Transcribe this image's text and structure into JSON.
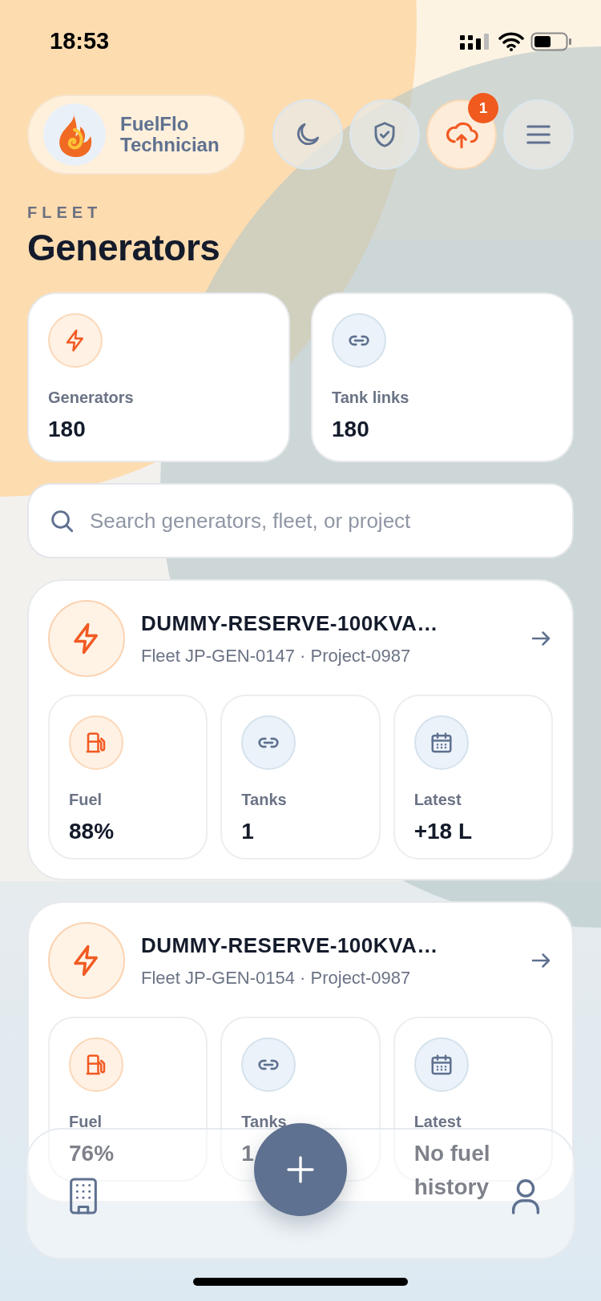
{
  "status_bar": {
    "time": "18:53"
  },
  "header": {
    "app_name": "FuelFlo",
    "role": "Technician",
    "sync_badge": "1"
  },
  "section_label": "FLEET",
  "title": "Generators",
  "summary": [
    {
      "kind": "power",
      "label": "Generators",
      "value": "180"
    },
    {
      "kind": "link",
      "label": "Tank links",
      "value": "180"
    }
  ],
  "search": {
    "placeholder": "Search generators, fleet, or project"
  },
  "generators": [
    {
      "name": "DUMMY-RESERVE-100KVA…",
      "subtitle": "Fleet JP-GEN-0147 · Project-0987",
      "stats": [
        {
          "kind": "fuel",
          "label": "Fuel",
          "value": "88%"
        },
        {
          "kind": "link",
          "label": "Tanks",
          "value": "1"
        },
        {
          "kind": "calendar",
          "label": "Latest",
          "value": "+18 L"
        }
      ]
    },
    {
      "name": "DUMMY-RESERVE-100KVA…",
      "subtitle": "Fleet JP-GEN-0154 · Project-0987",
      "stats": [
        {
          "kind": "fuel",
          "label": "Fuel",
          "value": "76%"
        },
        {
          "kind": "link",
          "label": "Tanks",
          "value": "1"
        },
        {
          "kind": "calendar",
          "label": "Latest",
          "value": "No fuel history"
        }
      ]
    }
  ]
}
